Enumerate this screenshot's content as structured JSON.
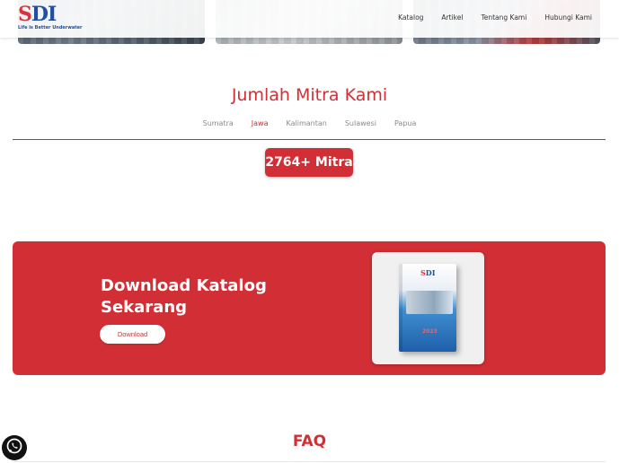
{
  "header": {
    "logo_text": "SDI",
    "logo_tagline": "Life is Better Underwater",
    "nav": [
      {
        "label": "Katalog"
      },
      {
        "label": "Artikel"
      },
      {
        "label": "Tentang Kami"
      },
      {
        "label": "Hubungi Kami"
      }
    ]
  },
  "mitra": {
    "title": "Jumlah Mitra Kami",
    "tabs": [
      {
        "label": "Sumatra",
        "active": false
      },
      {
        "label": "Jawa",
        "active": true
      },
      {
        "label": "Kalimantan",
        "active": false
      },
      {
        "label": "Sulawesi",
        "active": false
      },
      {
        "label": "Papua",
        "active": false
      }
    ],
    "count": "2764+ Mitra"
  },
  "banner": {
    "title": "Download Katalog Sekarang",
    "button": "Download",
    "catalog_logo": "SDI",
    "catalog_year": "2023"
  },
  "faq": {
    "title": "FAQ"
  },
  "colors": {
    "accent": "#d12f35",
    "brand_blue": "#1f4fa3",
    "whatsapp": "#111111"
  },
  "icons": {
    "whatsapp": "whatsapp-icon"
  }
}
